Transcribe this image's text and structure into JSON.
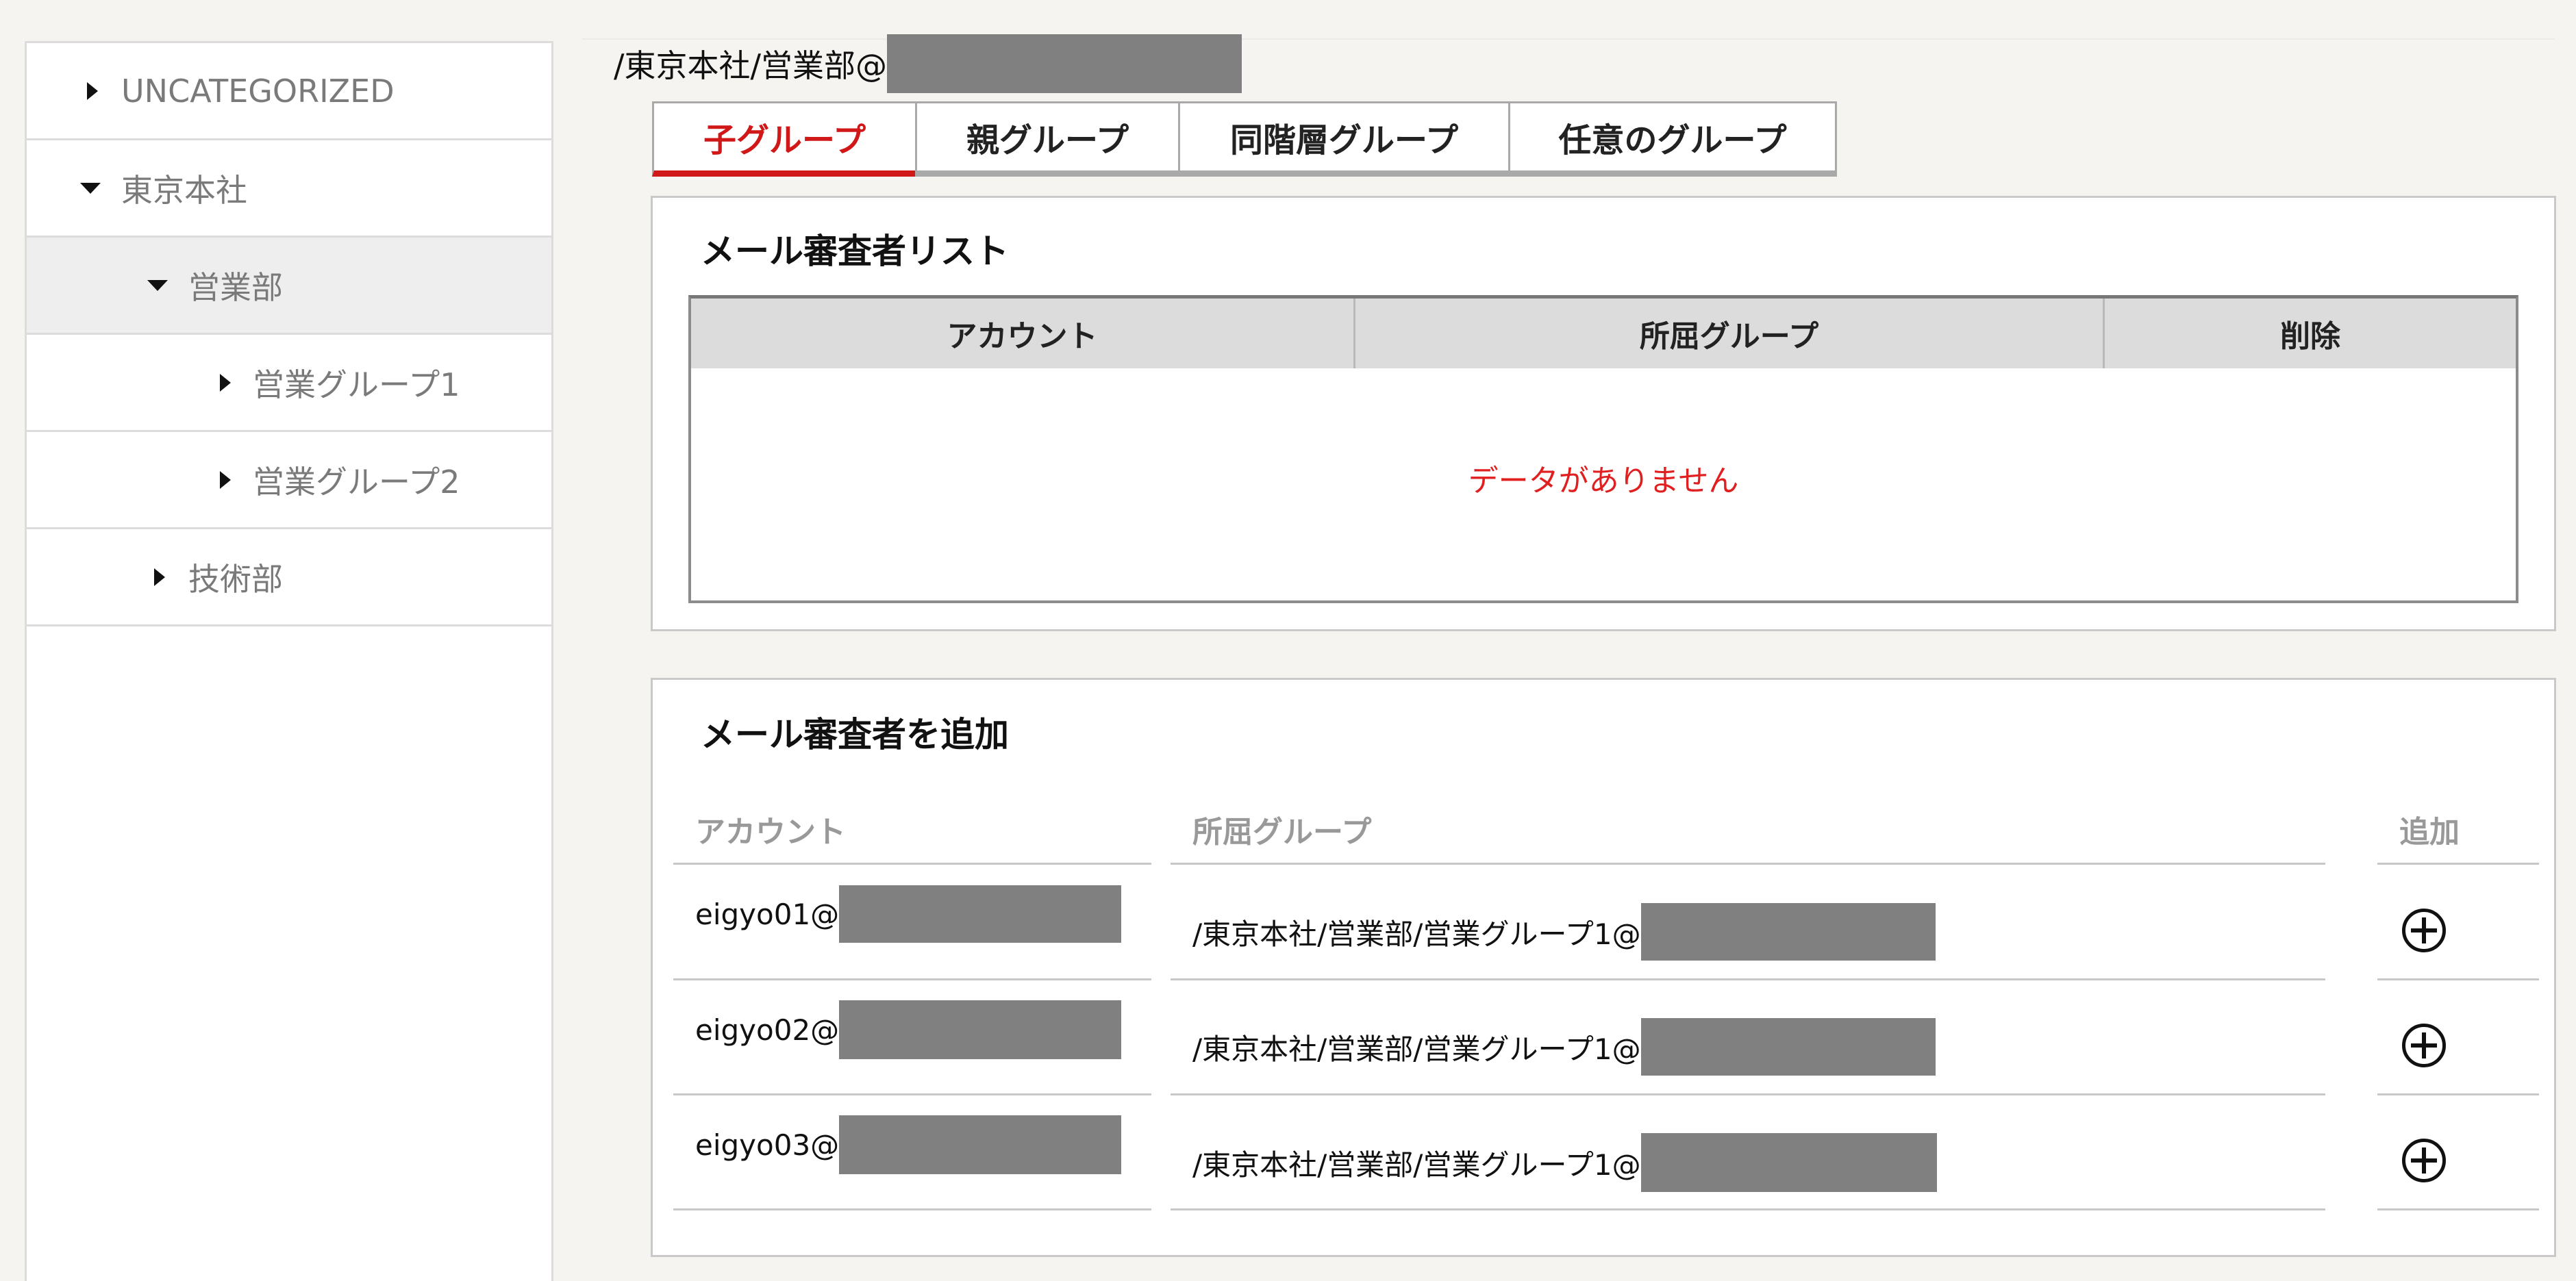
{
  "breadcrumb": {
    "path": "/東京本社/営業部@"
  },
  "sidebar": {
    "items": [
      {
        "label": "UNCATEGORIZED",
        "expanded": false
      },
      {
        "label": "東京本社",
        "expanded": true
      },
      {
        "label": "営業部",
        "expanded": true,
        "selected": true
      },
      {
        "label": "営業グループ1",
        "expanded": false
      },
      {
        "label": "営業グループ2",
        "expanded": false
      },
      {
        "label": "技術部",
        "expanded": false
      }
    ]
  },
  "tabs": [
    {
      "label": "子グループ",
      "active": true
    },
    {
      "label": "親グループ",
      "active": false
    },
    {
      "label": "同階層グループ",
      "active": false
    },
    {
      "label": "任意のグループ",
      "active": false
    }
  ],
  "reviewer_list": {
    "title": "メール審査者リスト",
    "columns": [
      "アカウント",
      "所屈グループ",
      "削除"
    ],
    "empty_message": "データがありません"
  },
  "add_reviewer": {
    "title": "メール審査者を追加",
    "columns": [
      "アカウント",
      "所屈グループ",
      "追加"
    ],
    "rows": [
      {
        "account": "eigyo01@",
        "group": "/東京本社/営業部/営業グループ1@"
      },
      {
        "account": "eigyo02@",
        "group": "/東京本社/営業部/営業グループ1@"
      },
      {
        "account": "eigyo03@",
        "group": "/東京本社/営業部/営業グループ1@"
      }
    ]
  },
  "colors": {
    "accent": "#d01818",
    "empty_text": "#e02020",
    "redaction": "#808080"
  },
  "icons": {
    "expand": "caret-right-icon",
    "collapse": "caret-down-icon",
    "add": "plus-circle-icon"
  }
}
